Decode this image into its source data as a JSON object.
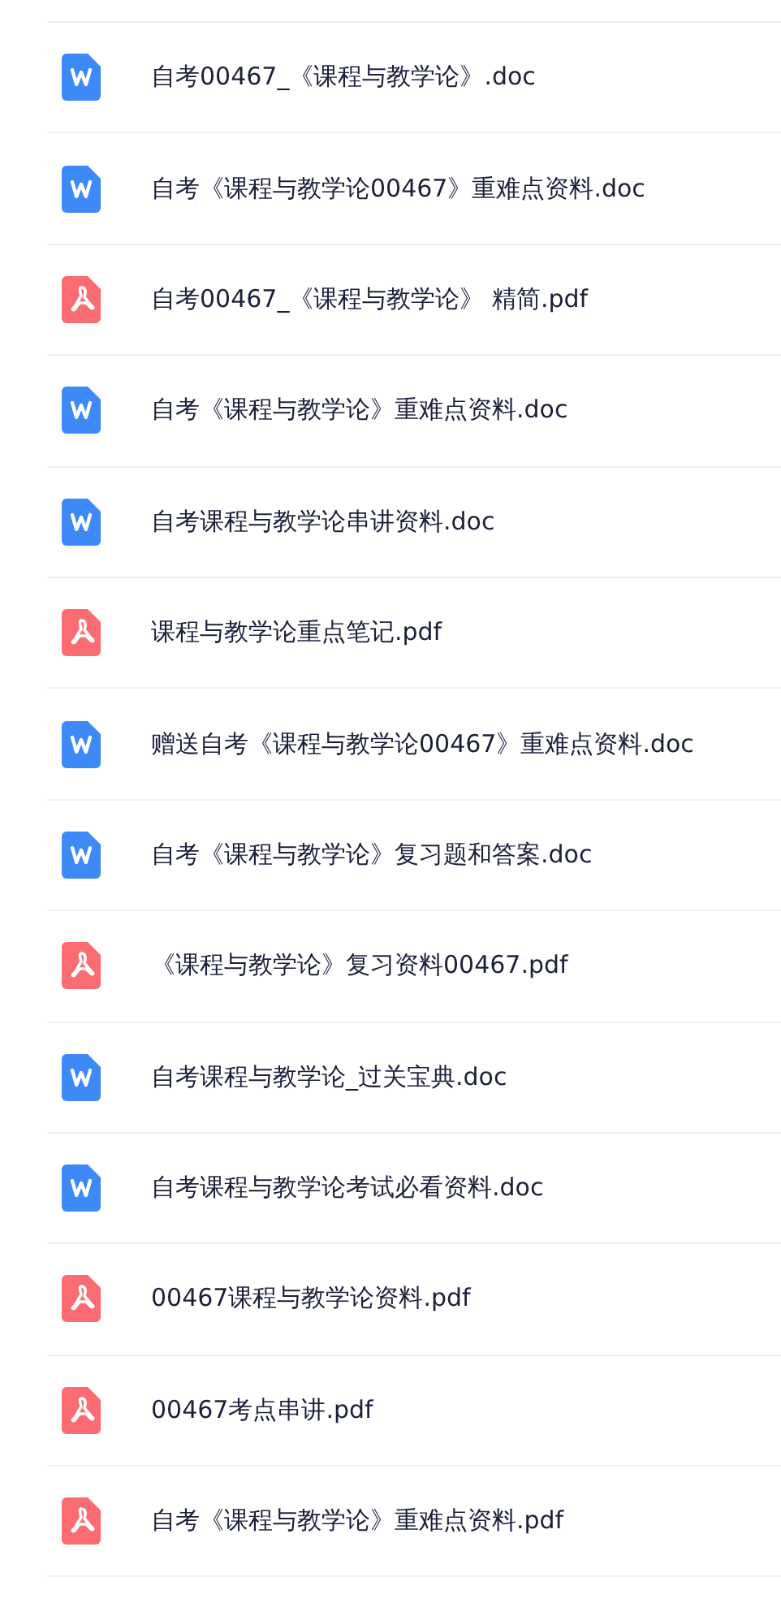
{
  "files": [
    {
      "kind": "doc",
      "name": "自考00467_《课程与教学论》.doc"
    },
    {
      "kind": "doc",
      "name": "自考《课程与教学论00467》重难点资料.doc"
    },
    {
      "kind": "pdf",
      "name": "自考00467_《课程与教学论》 精简.pdf"
    },
    {
      "kind": "doc",
      "name": "自考《课程与教学论》重难点资料.doc"
    },
    {
      "kind": "doc",
      "name": "自考课程与教学论串讲资料.doc"
    },
    {
      "kind": "pdf",
      "name": "课程与教学论重点笔记.pdf"
    },
    {
      "kind": "doc",
      "name": "赠送自考《课程与教学论00467》重难点资料.doc"
    },
    {
      "kind": "doc",
      "name": "自考《课程与教学论》复习题和答案.doc"
    },
    {
      "kind": "pdf",
      "name": "《课程与教学论》复习资料00467.pdf"
    },
    {
      "kind": "doc",
      "name": "自考课程与教学论_过关宝典.doc"
    },
    {
      "kind": "doc",
      "name": "自考课程与教学论考试必看资料.doc"
    },
    {
      "kind": "pdf",
      "name": "00467课程与教学论资料.pdf"
    },
    {
      "kind": "pdf",
      "name": "00467考点串讲.pdf"
    },
    {
      "kind": "pdf",
      "name": "自考《课程与教学论》重难点资料.pdf"
    }
  ]
}
